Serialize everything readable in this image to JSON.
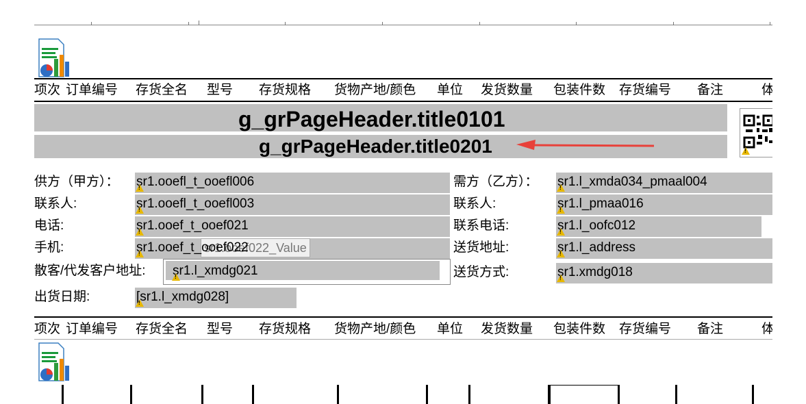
{
  "header_columns": [
    "项次",
    "订单编号",
    "存货全名",
    "型号",
    "存货规格",
    "货物产地/颜色",
    "单位",
    "发货数量",
    "包装件数",
    "存货编号",
    "备注",
    "体"
  ],
  "titles": {
    "title1": "g_grPageHeader.title0101",
    "title2": "g_grPageHeader.title0201"
  },
  "left_fields": [
    {
      "label": "供方（甲方）：",
      "value": "sr1.ooefl_t_ooefl006"
    },
    {
      "label": "联系人:",
      "value": "sr1.ooefl_t_ooefl003"
    },
    {
      "label": "电话:",
      "value": "sr1.ooef_t_ooef021"
    },
    {
      "label": "手机:",
      "value": "sr1.ooef_t_ooef022"
    },
    {
      "label": "散客/代发客户地址:",
      "value": "sr1.l_xmdg021"
    },
    {
      "label": "出货日期:",
      "value": "[sr1.l_xmdg028]"
    }
  ],
  "right_fields": [
    {
      "label": "需方（乙方）：",
      "value": "sr1.l_xmda034_pmaal004"
    },
    {
      "label": "联系人:",
      "value": "sr1.l_pmaa016"
    },
    {
      "label": "联系电话:",
      "value": "sr1.l_oofc012"
    },
    {
      "label": "送货地址:",
      "value": "sr1.l_address"
    },
    {
      "label": "送货方式:",
      "value": "sr1.xmdg018"
    }
  ],
  "tooltip": "sr1.ooef022_Value",
  "icons": {
    "report_icon": "report-chart-icon",
    "qr_icon": "qr-code-icon",
    "warning_icon": "warning-icon"
  },
  "colors": {
    "field_gray": "#c0c0c0",
    "arrow_red": "#e8413a"
  }
}
